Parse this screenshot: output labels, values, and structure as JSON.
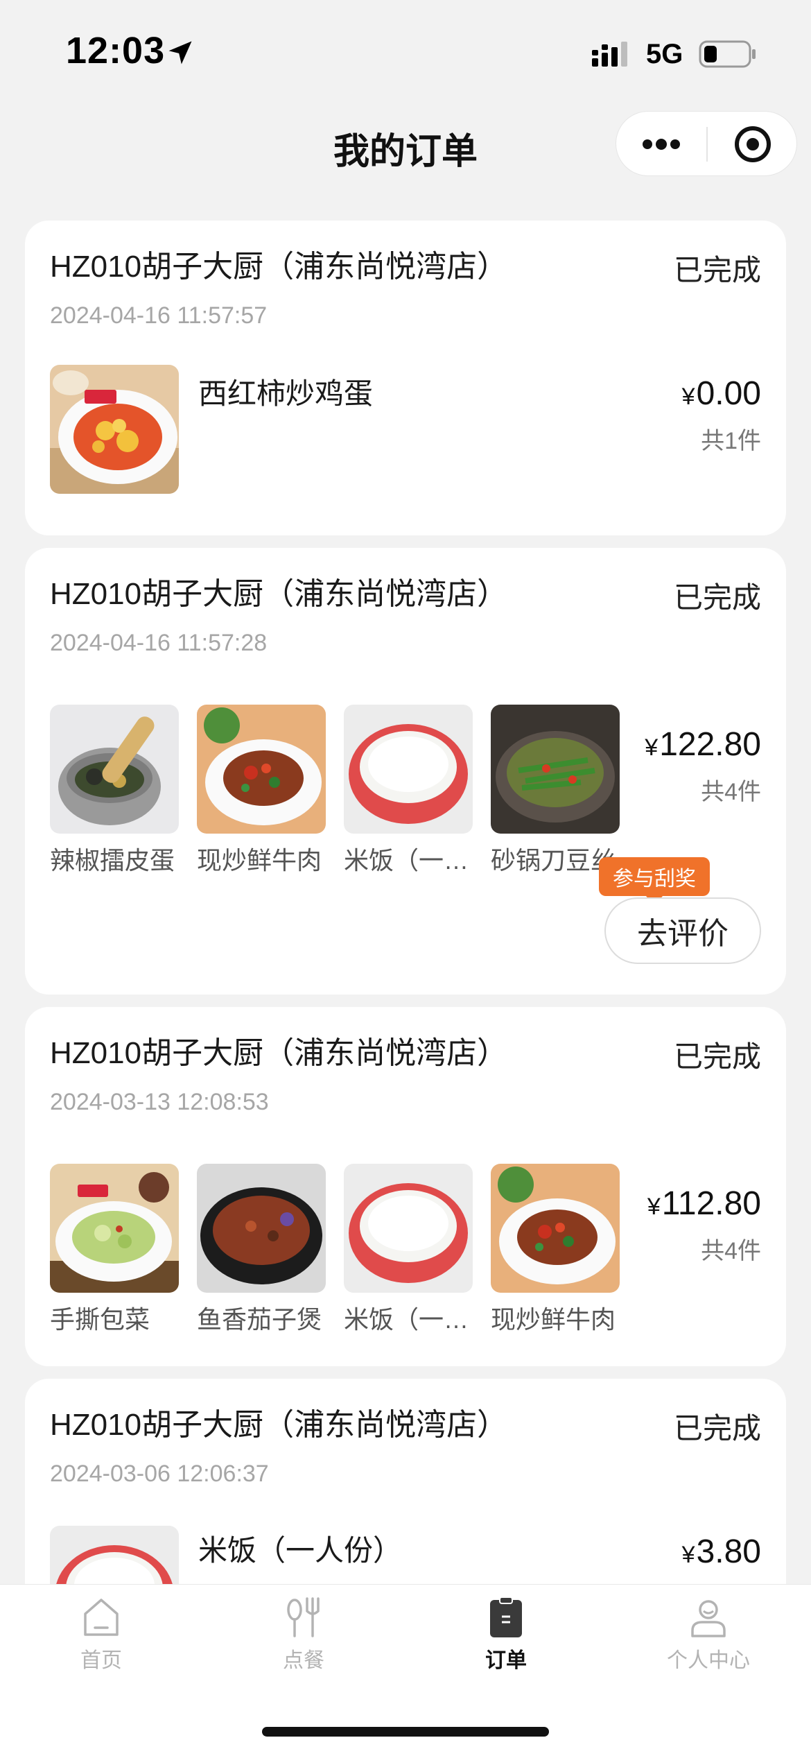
{
  "status_bar": {
    "time": "12:03",
    "network": "5G",
    "icons": [
      "location-arrow-icon",
      "signal-icon",
      "battery-icon"
    ]
  },
  "nav": {
    "title": "我的订单",
    "capsule_icons": [
      "more-dots-icon",
      "mini-program-close-icon"
    ]
  },
  "orders": [
    {
      "store": "HZ010胡子大厨（浦东尚悦湾店）",
      "status": "已完成",
      "time": "2024-04-16 11:57:57",
      "items": [
        {
          "name": "西红柿炒鸡蛋",
          "image": "tomato-egg"
        }
      ],
      "price_symbol": "¥",
      "price": "0.00",
      "count": "共1件"
    },
    {
      "store": "HZ010胡子大厨（浦东尚悦湾店）",
      "status": "已完成",
      "time": "2024-04-16 11:57:28",
      "items": [
        {
          "name": "辣椒擂皮蛋",
          "image": "pepper-egg-mortar"
        },
        {
          "name": "现炒鲜牛肉",
          "image": "stir-fried-beef"
        },
        {
          "name": "米饭（一人份）",
          "image": "rice-bowl"
        },
        {
          "name": "砂锅刀豆丝",
          "image": "clay-pot-beans"
        }
      ],
      "price_symbol": "¥",
      "price": "122.80",
      "count": "共4件",
      "review_button": "去评价",
      "lottery_tag": "参与刮奖"
    },
    {
      "store": "HZ010胡子大厨（浦东尚悦湾店）",
      "status": "已完成",
      "time": "2024-03-13 12:08:53",
      "items": [
        {
          "name": "手撕包菜",
          "image": "shredded-cabbage"
        },
        {
          "name": "鱼香茄子煲",
          "image": "eggplant-pot"
        },
        {
          "name": "米饭（一人份）",
          "image": "rice-bowl"
        },
        {
          "name": "现炒鲜牛肉",
          "image": "stir-fried-beef"
        }
      ],
      "price_symbol": "¥",
      "price": "112.80",
      "count": "共4件"
    },
    {
      "store": "HZ010胡子大厨（浦东尚悦湾店）",
      "status": "已完成",
      "time": "2024-03-06 12:06:37",
      "items": [
        {
          "name": "米饭（一人份）",
          "image": "rice-bowl"
        }
      ],
      "price_symbol": "¥",
      "price": "3.80"
    }
  ],
  "tabs": [
    {
      "label": "首页",
      "icon": "home-icon",
      "active": false
    },
    {
      "label": "点餐",
      "icon": "cutlery-icon",
      "active": false
    },
    {
      "label": "订单",
      "icon": "order-clipboard-icon",
      "active": true
    },
    {
      "label": "个人中心",
      "icon": "user-profile-icon",
      "active": false
    }
  ],
  "colors": {
    "background": "#f2f2f2",
    "card": "#ffffff",
    "accent_orange": "#f0722a",
    "muted_text": "#a6a6a6",
    "tab_inactive": "#b3b3b3"
  }
}
